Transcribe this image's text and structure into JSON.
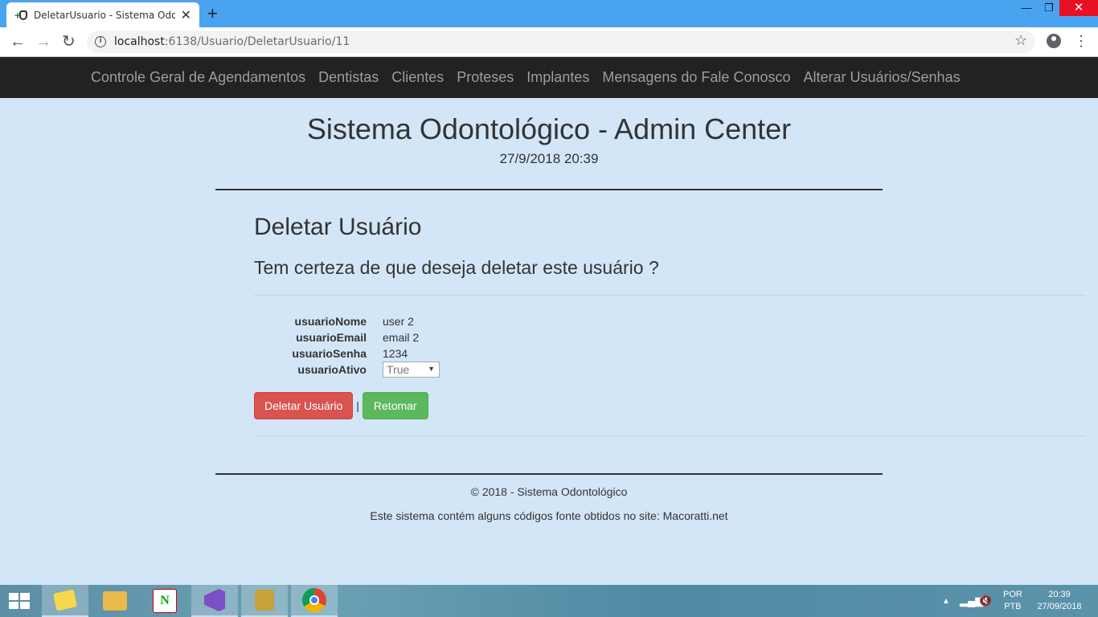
{
  "browser": {
    "tab_title": "DeletarUsuario - Sistema Odonto",
    "url_host": "localhost",
    "url_path": ":6138/Usuario/DeletarUsuario/11"
  },
  "nav": {
    "items": [
      "Controle Geral de Agendamentos",
      "Dentistas",
      "Clientes",
      "Proteses",
      "Implantes",
      "Mensagens do Fale Conosco",
      "Alterar Usuários/Senhas"
    ]
  },
  "header": {
    "title": "Sistema Odontológico - Admin Center",
    "datetime": "27/9/2018 20:39"
  },
  "page": {
    "heading": "Deletar Usuário",
    "question": "Tem certeza de que deseja deletar este usuário ?",
    "fields": [
      {
        "label": "usuarioNome",
        "value": "user 2"
      },
      {
        "label": "usuarioEmail",
        "value": "email 2"
      },
      {
        "label": "usuarioSenha",
        "value": "1234"
      },
      {
        "label": "usuarioAtivo",
        "value": "True"
      }
    ],
    "delete_button": "Deletar Usuário",
    "separator": "|",
    "back_button": "Retomar"
  },
  "footer": {
    "copyright": "© 2018 - Sistema Odontológico",
    "note": "Este sistema contém alguns códigos fonte obtidos no site: Macoratti.net"
  },
  "taskbar": {
    "lang_top": "POR",
    "lang_bottom": "PTB",
    "time": "20:39",
    "date": "27/09/2018"
  },
  "colors": {
    "page_bg": "#d3e6f8",
    "navbar_bg": "#222222",
    "danger": "#d9534f",
    "success": "#5cb85c"
  }
}
